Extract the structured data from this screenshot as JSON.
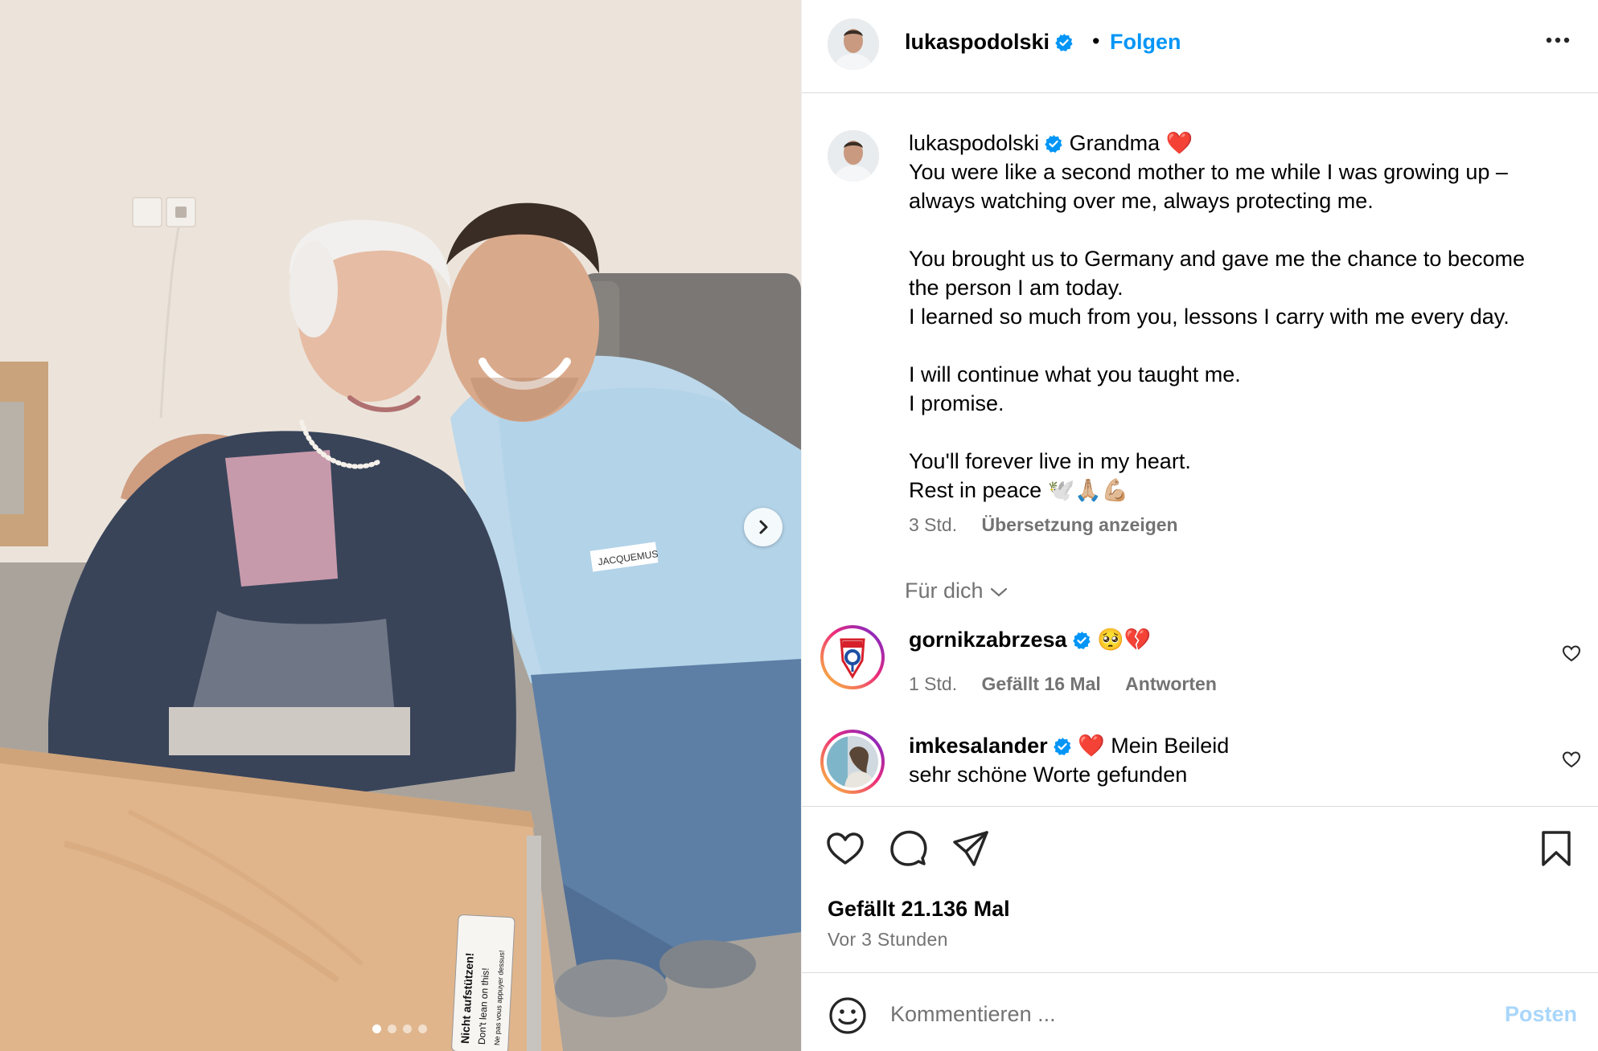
{
  "post": {
    "author": "lukaspodolski",
    "verified": true,
    "follow_label": "Folgen",
    "separator": "•",
    "more_icon": "more-horizontal-icon"
  },
  "photo": {
    "alt": "Photo of a smiling man in a light blue sweatshirt hugging an elderly woman in a blue and pink sweater",
    "shirt_label": "JACQUEMUS",
    "sign_lines": [
      "Nicht aufstützen!",
      "Don't lean on this!",
      "Ne pas vous appuyer dessus!"
    ],
    "carousel_count": 4,
    "carousel_active": 0,
    "next_icon": "chevron-right-icon"
  },
  "caption": {
    "username": "lukaspodolski",
    "first_line": "Grandma ❤️",
    "lines": [
      "You were like a second mother to me while I was growing up –",
      "always watching over me, always protecting me.",
      "",
      "You brought us to Germany and gave me the chance to become",
      "the person I am today.",
      "I learned so much from you, lessons I carry with me every day.",
      "",
      "I will continue what you taught me.",
      "I promise.",
      "",
      "You'll forever live in my heart.",
      "Rest in peace 🕊️🙏🏼💪🏼"
    ],
    "time": "3 Std.",
    "translate": "Übersetzung anzeigen"
  },
  "filter": {
    "label": "Für dich",
    "icon": "chevron-down-icon"
  },
  "comments": [
    {
      "username": "gornikzabrzesa",
      "verified": true,
      "text": "🥺💔",
      "time": "1 Std.",
      "likes": "Gefällt 16 Mal",
      "reply": "Antworten"
    },
    {
      "username": "imkesalander",
      "verified": true,
      "text": "❤️ Mein Beileid",
      "text2": "sehr schöne Worte gefunden"
    }
  ],
  "actions": {
    "like_icon": "heart-icon",
    "comment_icon": "comment-icon",
    "share_icon": "send-icon",
    "save_icon": "bookmark-icon",
    "likes_text": "Gefällt 21.136 Mal",
    "timestamp": "Vor 3 Stunden"
  },
  "composer": {
    "placeholder": "Kommentieren ...",
    "post_label": "Posten",
    "emoji_icon": "emoji-icon"
  },
  "colors": {
    "accent": "#0095f6",
    "muted": "#737373",
    "post_disabled": "#a9d6fb",
    "heart_red": "#ed1c3a"
  }
}
